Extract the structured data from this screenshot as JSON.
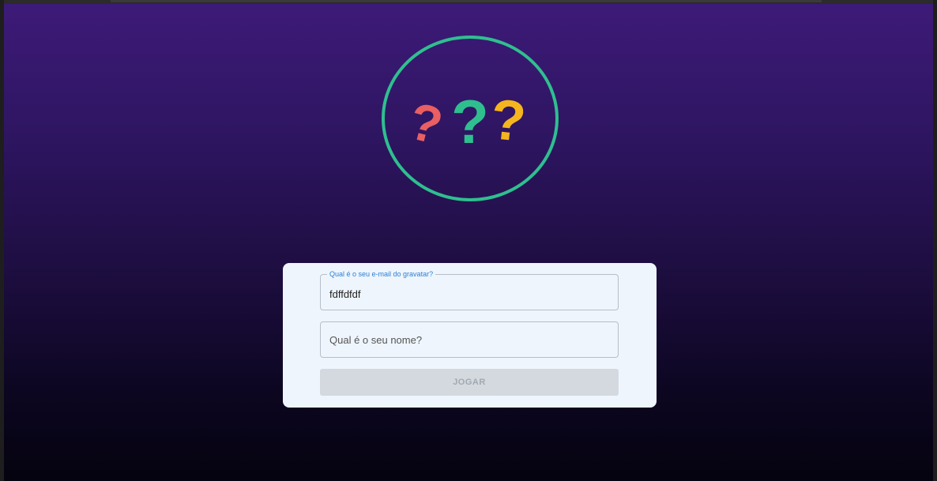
{
  "logo": {
    "icon": "question-marks-icon",
    "glyph": "?",
    "colors": {
      "ring": "#2fbf8f",
      "left_mark": "#e95f62",
      "middle_mark": "#2fbf8f",
      "right_mark": "#f5b51e"
    }
  },
  "form": {
    "email_label": "Qual é o seu e-mail do gravatar?",
    "email_value": "fdffdfdf",
    "name_placeholder": "Qual é o seu nome?",
    "name_value": "",
    "play_button_label": "JOGAR",
    "play_button_disabled": true
  },
  "colors": {
    "accent": "#2f7fd1",
    "background_top": "#3d1a78",
    "background_bottom": "#05030f",
    "card": "#eef5fd"
  }
}
